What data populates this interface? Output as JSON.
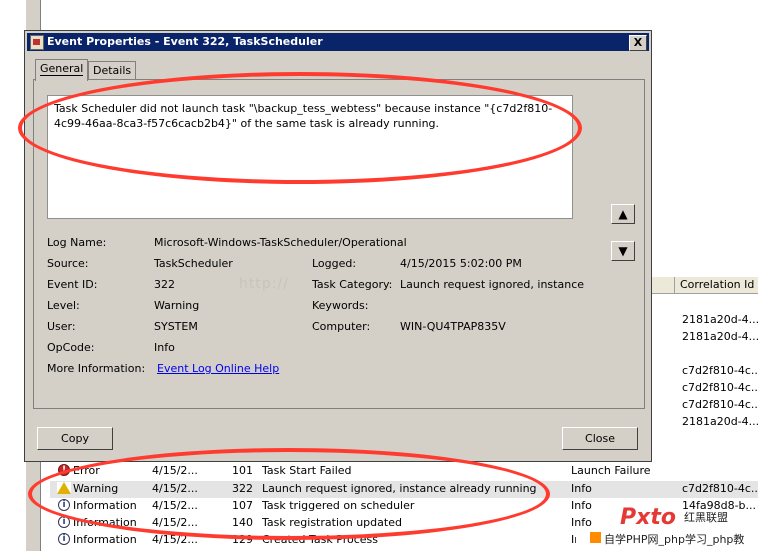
{
  "dialog": {
    "title": "Event Properties - Event 322, TaskScheduler",
    "close_glyph": "X",
    "tabs": [
      {
        "label": "General"
      },
      {
        "label": "Details"
      }
    ],
    "description": "Task Scheduler did not launch task \"\\backup_tess_webtess\"  because instance \"{c7d2f810-4c99-46aa-8ca3-f57c6cacb2b4}\"  of the same task is already running.",
    "arrow_up": "▲",
    "arrow_down": "▼",
    "fields": {
      "log_name": {
        "label": "Log Name:",
        "value": "Microsoft-Windows-TaskScheduler/Operational"
      },
      "source": {
        "label": "Source:",
        "value": "TaskScheduler"
      },
      "logged": {
        "label": "Logged:",
        "value": "4/15/2015 5:02:00 PM"
      },
      "event_id": {
        "label": "Event ID:",
        "value": "322"
      },
      "task_category": {
        "label": "Task Category:",
        "value": "Launch request ignored, instance"
      },
      "level": {
        "label": "Level:",
        "value": "Warning"
      },
      "keywords": {
        "label": "Keywords:",
        "value": ""
      },
      "user": {
        "label": "User:",
        "value": "SYSTEM"
      },
      "computer": {
        "label": "Computer:",
        "value": "WIN-QU4TPAP835V"
      },
      "opcode": {
        "label": "OpCode:",
        "value": "Info"
      },
      "more_info": {
        "label": "More Information:",
        "link": "Event Log Online Help"
      }
    },
    "watermark": "http://",
    "copy_label": "Copy",
    "close_label": "Close"
  },
  "background": {
    "column_header": "Correlation Id",
    "correlation_ids": [
      "2181a20d-4...",
      "2181a20d-4...",
      "c7d2f810-4c...",
      "c7d2f810-4c...",
      "c7d2f810-4c...",
      "2181a20d-4..."
    ]
  },
  "event_rows": [
    {
      "level": "Error",
      "icon": "error-icon",
      "date": "4/15/2...",
      "id": "101",
      "task": "Task Start Failed",
      "opcode": "Launch Failure",
      "corr": ""
    },
    {
      "level": "Warning",
      "icon": "warning-icon",
      "date": "4/15/2...",
      "id": "322",
      "task": "Launch request ignored, instance already running",
      "opcode": "Info",
      "corr": "c7d2f810-4c..."
    },
    {
      "level": "Information",
      "icon": "info-icon",
      "date": "4/15/2...",
      "id": "107",
      "task": "Task triggered on scheduler",
      "opcode": "Info",
      "corr": "14fa98d8-b..."
    },
    {
      "level": "Information",
      "icon": "info-icon",
      "date": "4/15/2...",
      "id": "140",
      "task": "Task registration updated",
      "opcode": "Info",
      "corr": ""
    },
    {
      "level": "Information",
      "icon": "info-icon",
      "date": "4/15/2...",
      "id": "129",
      "task": "Created Task Process",
      "opcode": "Info",
      "corr": ""
    }
  ],
  "logo": {
    "main": "Pxto",
    "cn": "红黑联盟",
    "bar": "自学PHP网_php学习_php教"
  },
  "colors": {
    "titlebar": "#0a246a",
    "dialog_bg": "#d4d0c8",
    "annotation": "#ff3b30",
    "link": "#0000ee"
  }
}
